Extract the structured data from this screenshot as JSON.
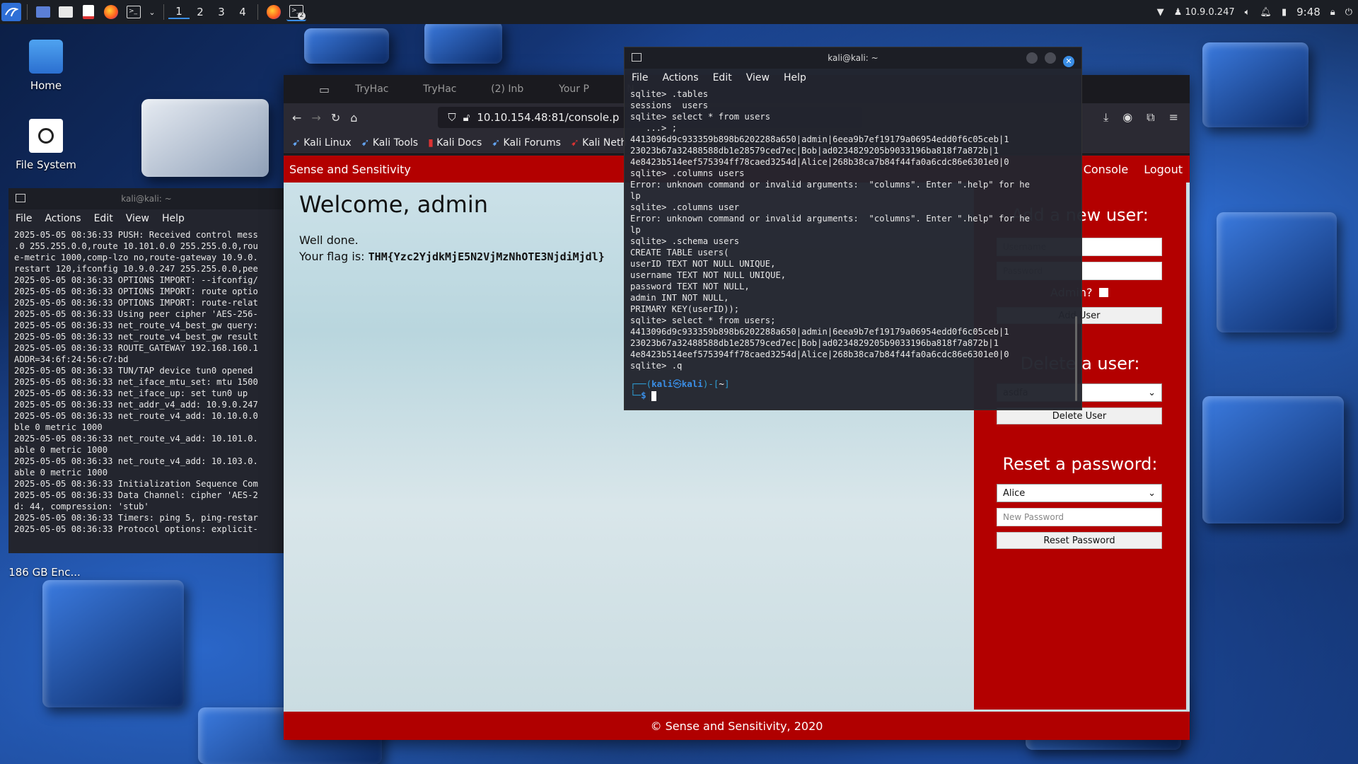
{
  "panel": {
    "workspaces": [
      "1",
      "2",
      "3",
      "4"
    ],
    "ip": "10.9.0.247",
    "clock": "9:48",
    "terminal_badge": "2"
  },
  "desktop": {
    "icons": [
      "Home",
      "File System",
      "186 GB Enc..."
    ]
  },
  "left_terminal": {
    "title": "kali@kali: ~",
    "menu": [
      "File",
      "Actions",
      "Edit",
      "View",
      "Help"
    ],
    "lines": [
      "2025-05-05 08:36:33 PUSH: Received control mess",
      ".0 255.255.0.0,route 10.101.0.0 255.255.0.0,rou",
      "e-metric 1000,comp-lzo no,route-gateway 10.9.0.",
      "restart 120,ifconfig 10.9.0.247 255.255.0.0,pee",
      "2025-05-05 08:36:33 OPTIONS IMPORT: --ifconfig/",
      "2025-05-05 08:36:33 OPTIONS IMPORT: route optio",
      "2025-05-05 08:36:33 OPTIONS IMPORT: route-relat",
      "2025-05-05 08:36:33 Using peer cipher 'AES-256-",
      "2025-05-05 08:36:33 net_route_v4_best_gw query:",
      "2025-05-05 08:36:33 net_route_v4_best_gw result",
      "2025-05-05 08:36:33 ROUTE_GATEWAY 192.168.160.1",
      "ADDR=34:6f:24:56:c7:bd",
      "2025-05-05 08:36:33 TUN/TAP device tun0 opened",
      "2025-05-05 08:36:33 net_iface_mtu_set: mtu 1500",
      "2025-05-05 08:36:33 net_iface_up: set tun0 up",
      "2025-05-05 08:36:33 net_addr_v4_add: 10.9.0.247",
      "2025-05-05 08:36:33 net_route_v4_add: 10.10.0.0",
      "ble 0 metric 1000",
      "2025-05-05 08:36:33 net_route_v4_add: 10.101.0.",
      "able 0 metric 1000",
      "2025-05-05 08:36:33 net_route_v4_add: 10.103.0.",
      "able 0 metric 1000",
      "2025-05-05 08:36:33 Initialization Sequence Com",
      "2025-05-05 08:36:33 Data Channel: cipher 'AES-2",
      "d: 44, compression: 'stub'",
      "2025-05-05 08:36:33 Timers: ping 5, ping-restar",
      "2025-05-05 08:36:33 Protocol options: explicit-"
    ]
  },
  "browser": {
    "tabs": [
      "TryHac",
      "TryHac",
      "(2) Inb",
      "Your P",
      "N"
    ],
    "url": "10.10.154.48:81/console.p",
    "bookmarks": [
      "Kali Linux",
      "Kali Tools",
      "Kali Docs",
      "Kali Forums",
      "Kali Neth"
    ],
    "site": {
      "brand": "Sense and Sensitivity",
      "nav": [
        "Console",
        "Logout"
      ],
      "welcome": "Welcome, admin",
      "well_done": "Well done.",
      "flag_label": "Your flag is:",
      "flag": "THM{Yzc2YjdkMjE5N2VjMzNhOTE3NjdiMjdl}",
      "footer": "© Sense and Sensitivity, 2020",
      "add_user": {
        "heading": "Add a new user:",
        "username_placeholder": "Username",
        "password_placeholder": "Password",
        "admin_label": "Admin?",
        "button": "Add User"
      },
      "delete_user": {
        "heading": "Delete a user:",
        "selected": "asdfa",
        "button": "Delete User"
      },
      "reset_password": {
        "heading": "Reset a password:",
        "selected": "Alice",
        "placeholder": "New Password",
        "button": "Reset Password"
      }
    }
  },
  "main_terminal": {
    "title": "kali@kali: ~",
    "menu": [
      "File",
      "Actions",
      "Edit",
      "View",
      "Help"
    ],
    "lines": [
      "sqlite> .tables",
      "sessions  users",
      "sqlite> select * from users",
      "   ...> ;",
      "4413096d9c933359b898b6202288a650|admin|6eea9b7ef19179a06954edd0f6c05ceb|1",
      "23023b67a32488588db1e28579ced7ec|Bob|ad0234829205b9033196ba818f7a872b|1",
      "4e8423b514eef575394ff78caed3254d|Alice|268b38ca7b84f44fa0a6cdc86e6301e0|0",
      "sqlite> .columns users",
      "Error: unknown command or invalid arguments:  \"columns\". Enter \".help\" for he",
      "lp",
      "sqlite> .columns user",
      "Error: unknown command or invalid arguments:  \"columns\". Enter \".help\" for he",
      "lp",
      "sqlite> .schema users",
      "CREATE TABLE users(",
      "userID TEXT NOT NULL UNIQUE,",
      "username TEXT NOT NULL UNIQUE,",
      "password TEXT NOT NULL,",
      "admin INT NOT NULL,",
      "PRIMARY KEY(userID));",
      "sqlite> select * from users;",
      "4413096d9c933359b898b6202288a650|admin|6eea9b7ef19179a06954edd0f6c05ceb|1",
      "23023b67a32488588db1e28579ced7ec|Bob|ad0234829205b9033196ba818f7a872b|1",
      "4e8423b514eef575394ff78caed3254d|Alice|268b38ca7b84f44fa0a6cdc86e6301e0|0",
      "sqlite> .q"
    ],
    "prompt_user": "kali",
    "prompt_host": "kali",
    "prompt_dir": "~"
  },
  "colors": {
    "site_red": "#b30000",
    "prompt_blue": "#3a8ee6",
    "prompt_path": "#2e9fd8"
  }
}
